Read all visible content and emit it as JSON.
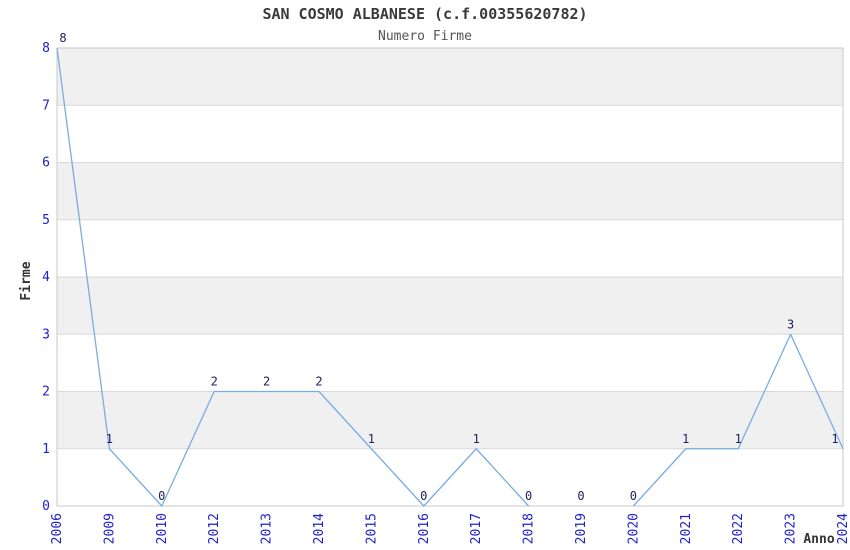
{
  "chart_data": {
    "type": "line",
    "title": "SAN COSMO ALBANESE (c.f.00355620782)",
    "subtitle": "Numero Firme",
    "xlabel": "Anno",
    "ylabel": "Firme",
    "categories": [
      "2006",
      "2009",
      "2010",
      "2012",
      "2013",
      "2014",
      "2015",
      "2016",
      "2017",
      "2018",
      "2019",
      "2020",
      "2021",
      "2022",
      "2023",
      "2024"
    ],
    "values": [
      8,
      1,
      0,
      2,
      2,
      2,
      1,
      0,
      1,
      0,
      0,
      0,
      1,
      1,
      3,
      1
    ],
    "line_segments": [
      [
        0,
        9
      ],
      [
        11,
        15
      ]
    ],
    "ylim": [
      0,
      8
    ],
    "yticks": [
      0,
      1,
      2,
      3,
      4,
      5,
      6,
      7,
      8
    ],
    "grid": "horizontal",
    "band_fill_ranges": [
      [
        1,
        2
      ],
      [
        3,
        4
      ],
      [
        5,
        6
      ],
      [
        7,
        8
      ]
    ],
    "legend_position": "none",
    "colors": {
      "line": "#79ade3",
      "tick_label": "#2121cc",
      "data_label": "#20205e",
      "band": "#f0f0f0",
      "grid": "#d9d9d9",
      "border": "#c9c9c9",
      "title": "#3a3a3a",
      "subtitle": "#555555",
      "axis_label": "#333333",
      "background": "#ffffff"
    }
  }
}
